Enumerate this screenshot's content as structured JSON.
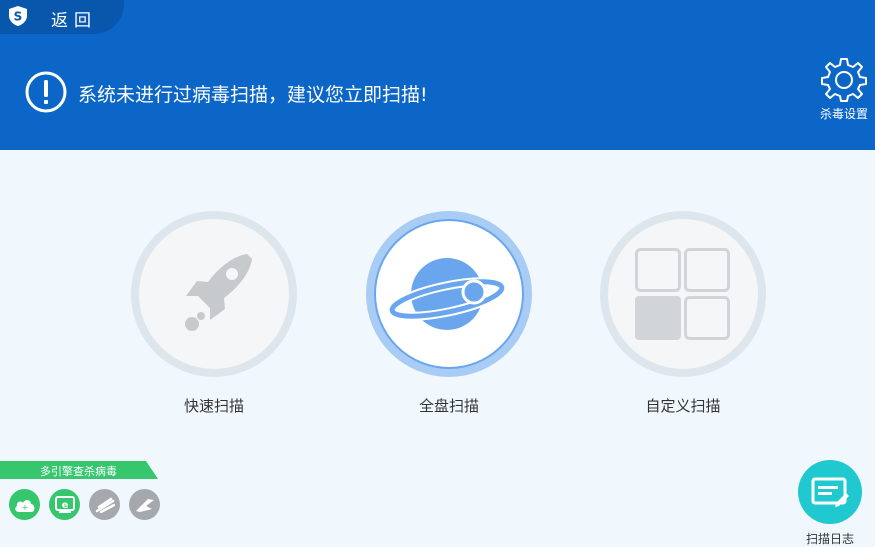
{
  "header": {
    "back_label": "返回",
    "alert_text": "系统未进行过病毒扫描，建议您立即扫描!",
    "settings_label": "杀毒设置"
  },
  "scan_options": [
    {
      "label": "快速扫描",
      "icon": "rocket-icon"
    },
    {
      "label": "全盘扫描",
      "icon": "planet-icon"
    },
    {
      "label": "自定义扫描",
      "icon": "grid-icon"
    }
  ],
  "engines": {
    "label": "多引擎查杀病毒",
    "icons": [
      "cloud-engine-icon",
      "internet-engine-icon",
      "engine-icon-3",
      "engine-icon-4"
    ]
  },
  "scan_log": {
    "label": "扫描日志"
  },
  "colors": {
    "header_bg": "#0b66c8",
    "page_bg": "#f0f8fe",
    "accent_green": "#36c66e",
    "log_teal": "#1fc9cf"
  }
}
